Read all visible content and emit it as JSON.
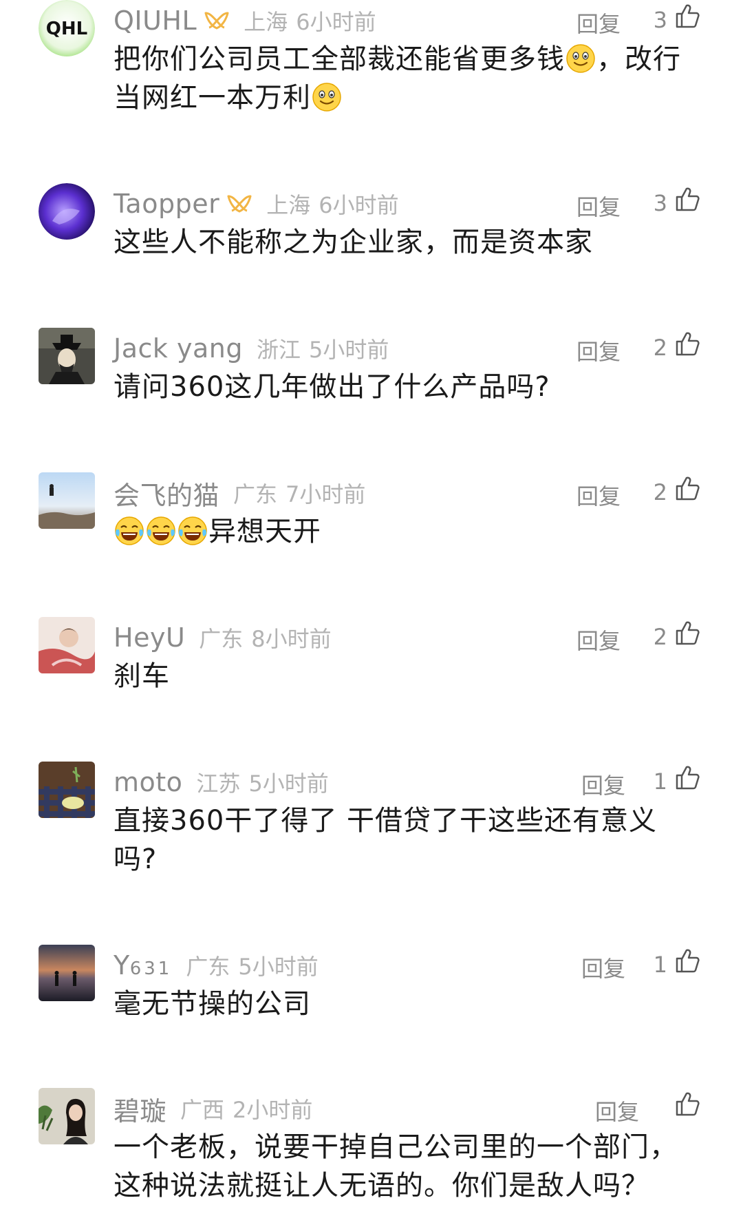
{
  "comments": [
    {
      "username": "QIUHL",
      "location": "上海",
      "time": "6小时前",
      "reply": "回复",
      "likes": "3",
      "text_a": "把你们公司员工全部裁还能省更多钱",
      "text_b": "，改行当网红一本万利",
      "emoji": "smile-emoji",
      "avatar_text": "QHL"
    },
    {
      "username": "Taopper",
      "location": "上海",
      "time": "6小时前",
      "reply": "回复",
      "likes": "3",
      "text": "这些人不能称之为企业家，而是资本家"
    },
    {
      "username": "Jack yang",
      "location": "浙江",
      "time": "5小时前",
      "reply": "回复",
      "likes": "2",
      "text": "请问360这几年做出了什么产品吗?"
    },
    {
      "username": "会飞的猫",
      "location": "广东",
      "time": "7小时前",
      "reply": "回复",
      "likes": "2",
      "text": "异想天开",
      "emoji": "laugh-cry-emoji"
    },
    {
      "username": "HeyU",
      "location": "广东",
      "time": "8小时前",
      "reply": "回复",
      "likes": "2",
      "text": "刹车"
    },
    {
      "username": "moto",
      "location": "江苏",
      "time": "5小时前",
      "reply": "回复",
      "likes": "1",
      "text": "直接360干了得了 干借贷了干这些还有意义吗?"
    },
    {
      "username": "Y",
      "username_sub": "631",
      "location": "广东",
      "time": "5小时前",
      "reply": "回复",
      "likes": "1",
      "text": "毫无节操的公司"
    },
    {
      "username": "碧璇",
      "location": "广西",
      "time": "2小时前",
      "reply": "回复",
      "likes": "",
      "text": "一个老板，说要干掉自己公司里的一个部门，这种说法就挺让人无语的。你们是敌人吗？"
    }
  ],
  "icons": {
    "vip": "vip-badge-icon",
    "like": "thumbs-up-icon"
  },
  "colors": {
    "meta_gray": "#8a8a8a",
    "light_gray": "#b3b3b3",
    "vip_gold": "#f2b544",
    "text": "#1a1a1a"
  }
}
